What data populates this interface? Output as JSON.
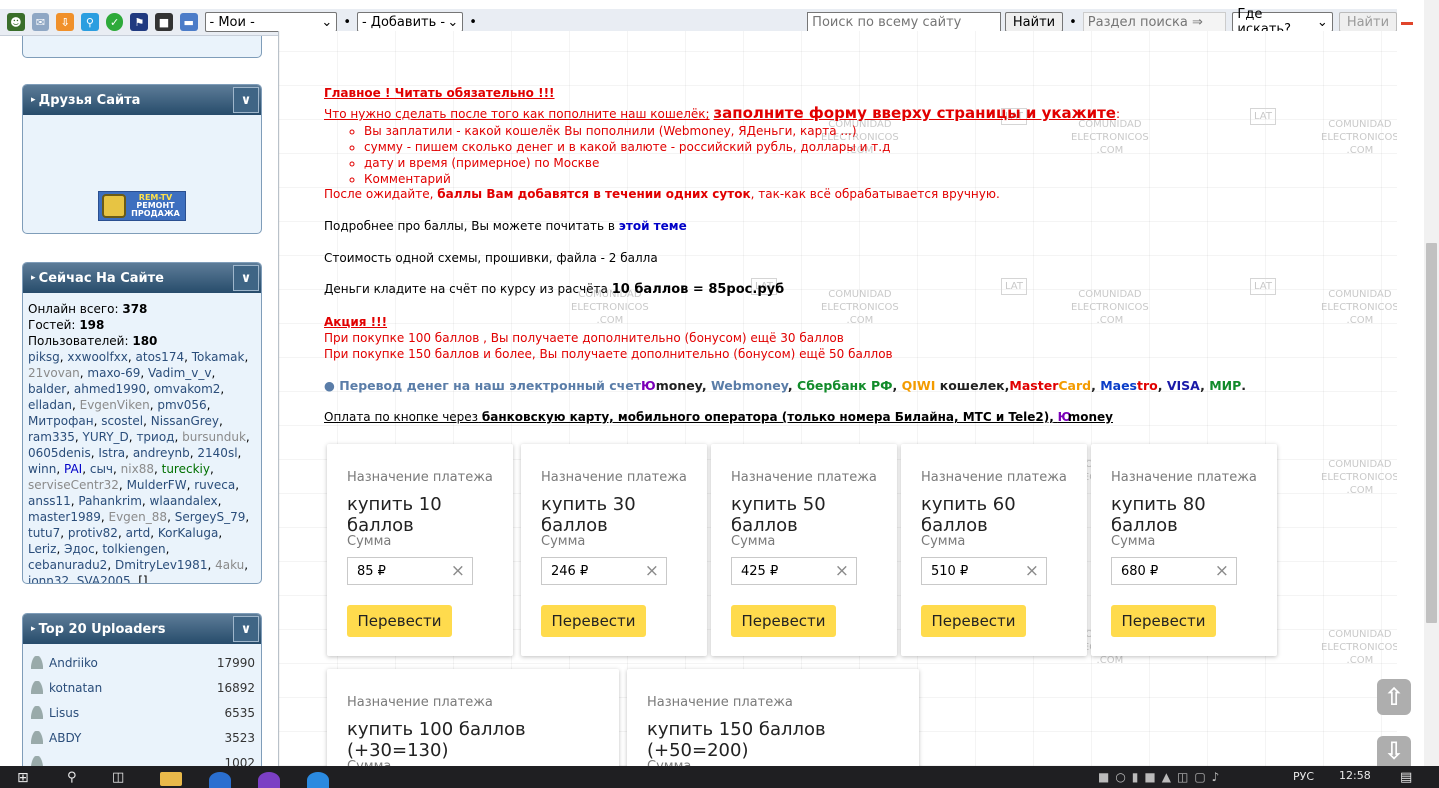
{
  "toolbar": {
    "icons": [
      "user-icon",
      "mail-icon",
      "download-icon",
      "search-icon",
      "check-icon",
      "flag-icon",
      "chip-icon",
      "book-icon"
    ],
    "select_mine": "- Мои -",
    "select_add": "- Добавить -",
    "search_placeholder": "Поиск по всему сайту",
    "search_btn": "Найти",
    "section_placeholder": "Раздел поиска ⇒",
    "where_select": "Где искать?",
    "search_btn2": "Найти"
  },
  "sidebar": {
    "friends": {
      "title": "Друзья Сайта",
      "banner_line1": "REM-TV",
      "banner_line2": "РЕМОНТ",
      "banner_line3": "ПРОДАЖА"
    },
    "online": {
      "title": "Сейчас На Сайте",
      "total_label": "Онлайн всего:",
      "total": "378",
      "guests_label": "Гостей:",
      "guests": "198",
      "users_label": "Пользователей:",
      "users": "180",
      "names": [
        {
          "n": "piksg",
          "c": "link"
        },
        {
          "n": "xxwoolfxx",
          "c": "link"
        },
        {
          "n": "atos174",
          "c": "link"
        },
        {
          "n": "Tokamak",
          "c": "link"
        },
        {
          "n": "21vovan",
          "c": "gray"
        },
        {
          "n": "maxo-69",
          "c": "link"
        },
        {
          "n": "Vadim_v_v",
          "c": "link"
        },
        {
          "n": "balder",
          "c": "link"
        },
        {
          "n": "ahmed1990",
          "c": "link"
        },
        {
          "n": "omvakom2",
          "c": "link"
        },
        {
          "n": "elladan",
          "c": "link"
        },
        {
          "n": "EvgenViken",
          "c": "gray"
        },
        {
          "n": "pmv056",
          "c": "link"
        },
        {
          "n": "Митрофан",
          "c": "link"
        },
        {
          "n": "scostel",
          "c": "link"
        },
        {
          "n": "NissanGrey",
          "c": "link"
        },
        {
          "n": "ram335",
          "c": "link"
        },
        {
          "n": "YURY_D",
          "c": "link"
        },
        {
          "n": "триод",
          "c": "link"
        },
        {
          "n": "bursunduk",
          "c": "gray"
        },
        {
          "n": "0605denis",
          "c": "link"
        },
        {
          "n": "Istra",
          "c": "link"
        },
        {
          "n": "andreynb",
          "c": "link"
        },
        {
          "n": "2140sl",
          "c": "link"
        },
        {
          "n": "winn",
          "c": "link"
        },
        {
          "n": "PAI",
          "c": "blue"
        },
        {
          "n": "сыч",
          "c": "link"
        },
        {
          "n": "nix88",
          "c": "gray"
        },
        {
          "n": "tureckiy",
          "c": "green"
        },
        {
          "n": "serviseCentr32",
          "c": "gray"
        },
        {
          "n": "MulderFW",
          "c": "link"
        },
        {
          "n": "ruveca",
          "c": "link"
        },
        {
          "n": "anss11",
          "c": "link"
        },
        {
          "n": "Pahankrim",
          "c": "link"
        },
        {
          "n": "wlaandalex",
          "c": "link"
        },
        {
          "n": "master1989",
          "c": "link"
        },
        {
          "n": "Evgen_88",
          "c": "gray"
        },
        {
          "n": "SergeyS_79",
          "c": "link"
        },
        {
          "n": "tutu7",
          "c": "link"
        },
        {
          "n": "protiv82",
          "c": "link"
        },
        {
          "n": "artd",
          "c": "link"
        },
        {
          "n": "KorKaluga",
          "c": "link"
        },
        {
          "n": "Leriz",
          "c": "link"
        },
        {
          "n": "Эдос",
          "c": "link"
        },
        {
          "n": "tolkiengen",
          "c": "link"
        },
        {
          "n": "cebanuradu2",
          "c": "link"
        },
        {
          "n": "DmitryLev1981",
          "c": "link"
        },
        {
          "n": "4aku",
          "c": "gray"
        },
        {
          "n": "jonn32",
          "c": "link"
        },
        {
          "n": "SVA2005",
          "c": "link"
        },
        {
          "n": "[]",
          "c": "plain"
        }
      ]
    },
    "uploaders": {
      "title": "Top 20 Uploaders",
      "rows": [
        {
          "name": "Andriiko",
          "count": "17990"
        },
        {
          "name": "kotnatan",
          "count": "16892"
        },
        {
          "name": "Lisus",
          "count": "6535"
        },
        {
          "name": "ABDY",
          "count": "3523"
        },
        {
          "name": "",
          "count": "1002"
        }
      ]
    }
  },
  "content": {
    "important": "Главное ! Читать обязательно !!!",
    "what_todo": "Что нужно сделать после того как пополните наш кошелёк;",
    "fill_form": "заполните форму вверху страницы и укажите",
    "colon": ":",
    "bullets": [
      "Вы заплатили - какой кошелёк Вы пополнили (Webmoney, ЯДеньги, карта ...)",
      "сумму - пишем сколько денег и в какой валюте - российский рубль, доллары и т.д",
      "дату и время (примерное) по Москве",
      "Комментарий"
    ],
    "wait_pre": "После ожидайте,",
    "wait_bold": "баллы Вам добавятся в течении одних суток",
    "wait_post": ", так-как всё обрабатывается вручную.",
    "more_pre": "Подробнее про баллы, Вы можете почитать в",
    "more_link": "этой теме",
    "cost": "Стоимость одной схемы, прошивки, файла - 2 балла",
    "rate_pre": "Деньги кладите на счёт по курсу из расчёта",
    "rate_bold": "10 баллов = 85рос.руб",
    "promo_title": "Акция !!!",
    "promo1": "При покупке 100 баллов , Вы получаете дополнительно (бонусом) ещё 30 баллов",
    "promo2": "При покупке 150 баллов и более, Вы получаете дополнительно (бонусом) ещё 50 баллов",
    "transfer": {
      "pre": "Перевод денег на наш электронный счет",
      "yu": "Ю",
      "money": "money",
      "comma1": ", ",
      "webmoney": "Webmoney",
      "comma2": ", ",
      "sber": "Сбербанк РФ",
      "comma3": ", ",
      "qiwi": "QIWI",
      "wallet": " кошелек,",
      "master1": "Master",
      "master2": "Card",
      "comma4": ", ",
      "maestro1": "Maes",
      "maestro2": "tro",
      "comma5": ", ",
      "visa": "VISA",
      "comma6": ", ",
      "mir": "МИР",
      "dot": "."
    },
    "payment_pre": "Оплата по кнопке через",
    "payment_bold": "банковскую карту, мобильного оператора (только номера Билайна, МТС и Tele2),",
    "payment_yu": "Ю",
    "payment_money": "money",
    "watermark": [
      "COMUNIDAD",
      "ELECTRONICOS",
      ".COM"
    ],
    "lat": "LAT"
  },
  "cards": [
    {
      "label": "Назначение платежа",
      "title": "купить 10 баллов",
      "sum_label": "Сумма",
      "value": "85 ₽",
      "button": "Перевести"
    },
    {
      "label": "Назначение платежа",
      "title": "купить 30 баллов",
      "sum_label": "Сумма",
      "value": "246 ₽",
      "button": "Перевести"
    },
    {
      "label": "Назначение платежа",
      "title": "купить 50 баллов",
      "sum_label": "Сумма",
      "value": "425 ₽",
      "button": "Перевести"
    },
    {
      "label": "Назначение платежа",
      "title": "купить 60 баллов",
      "sum_label": "Сумма",
      "value": "510 ₽",
      "button": "Перевести"
    },
    {
      "label": "Назначение платежа",
      "title": "купить 80 баллов",
      "sum_label": "Сумма",
      "value": "680 ₽",
      "button": "Перевести"
    },
    {
      "label": "Назначение платежа",
      "title": "купить 100 баллов (+30=130)",
      "sum_label": "Сумма"
    },
    {
      "label": "Назначение платежа",
      "title": "купить 150 баллов (+50=200)",
      "sum_label": "Сумма"
    }
  ],
  "nav": {
    "up": "⇧",
    "down": "⇩"
  },
  "taskbar": {
    "lang": "РУС",
    "time": "12:58"
  }
}
